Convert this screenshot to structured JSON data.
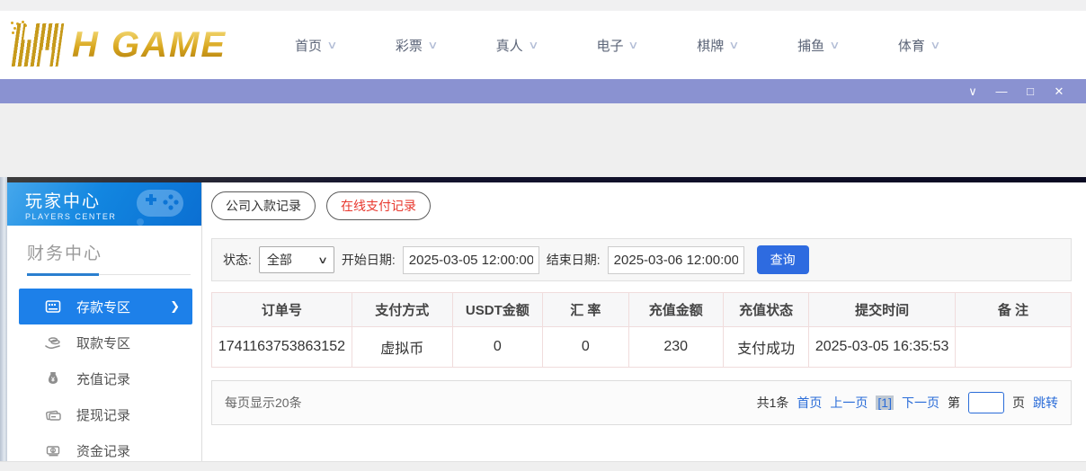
{
  "logo": {
    "text": "H GAME"
  },
  "nav": {
    "caret_glyph": "∨",
    "items": [
      {
        "label": "首页"
      },
      {
        "label": "彩票"
      },
      {
        "label": "真人"
      },
      {
        "label": "电子"
      },
      {
        "label": "棋牌"
      },
      {
        "label": "捕鱼"
      },
      {
        "label": "体育"
      }
    ]
  },
  "titlebar": {
    "controls": [
      {
        "name": "dropdown",
        "glyph": "∨"
      },
      {
        "name": "minimize",
        "glyph": "—"
      },
      {
        "name": "maximize",
        "glyph": "□"
      },
      {
        "name": "close",
        "glyph": "✕"
      }
    ]
  },
  "sidebar": {
    "header": {
      "title": "玩家中心",
      "subtitle": "PLAYERS CENTER"
    },
    "section_title": "财务中心",
    "arrow_glyph": "❯",
    "items": [
      {
        "label": "存款专区",
        "active": true
      },
      {
        "label": "取款专区",
        "active": false
      },
      {
        "label": "充值记录",
        "active": false
      },
      {
        "label": "提现记录",
        "active": false
      },
      {
        "label": "资金记录",
        "active": false
      }
    ]
  },
  "main": {
    "tabs": [
      {
        "label": "公司入款记录",
        "active": false
      },
      {
        "label": "在线支付记录",
        "active": true
      }
    ],
    "filters": {
      "status_label": "状态:",
      "status_value": "全部",
      "caret_glyph": "∨",
      "start_label": "开始日期:",
      "start_value": "2025-03-05 12:00:00",
      "end_label": "结束日期:",
      "end_value": "2025-03-06 12:00:00",
      "query_button": "查询"
    },
    "table": {
      "headers": [
        "订单号",
        "支付方式",
        "USDT金额",
        "汇 率",
        "充值金额",
        "充值状态",
        "提交时间",
        "备 注"
      ],
      "rows": [
        [
          "1741163753863152",
          "虚拟币",
          "0",
          "0",
          "230",
          "支付成功",
          "2025-03-05 16:35:53",
          ""
        ]
      ]
    },
    "pagination": {
      "page_size_text": "每页显示20条",
      "total_text": "共1条",
      "first": "首页",
      "prev": "上一页",
      "current": "[1]",
      "next": "下一页",
      "goto_prefix": "第",
      "goto_suffix": "页",
      "goto_button": "跳转"
    }
  },
  "colors": {
    "titlebar": "#8a92d1",
    "sidebar_active": "#1d80e9",
    "banner_blue": "#0b6fd2",
    "query_button": "#2e6be0",
    "tab_active_red": "#e8382e",
    "link_blue": "#2a6cd8",
    "logo_gold": "#d8a61e"
  }
}
